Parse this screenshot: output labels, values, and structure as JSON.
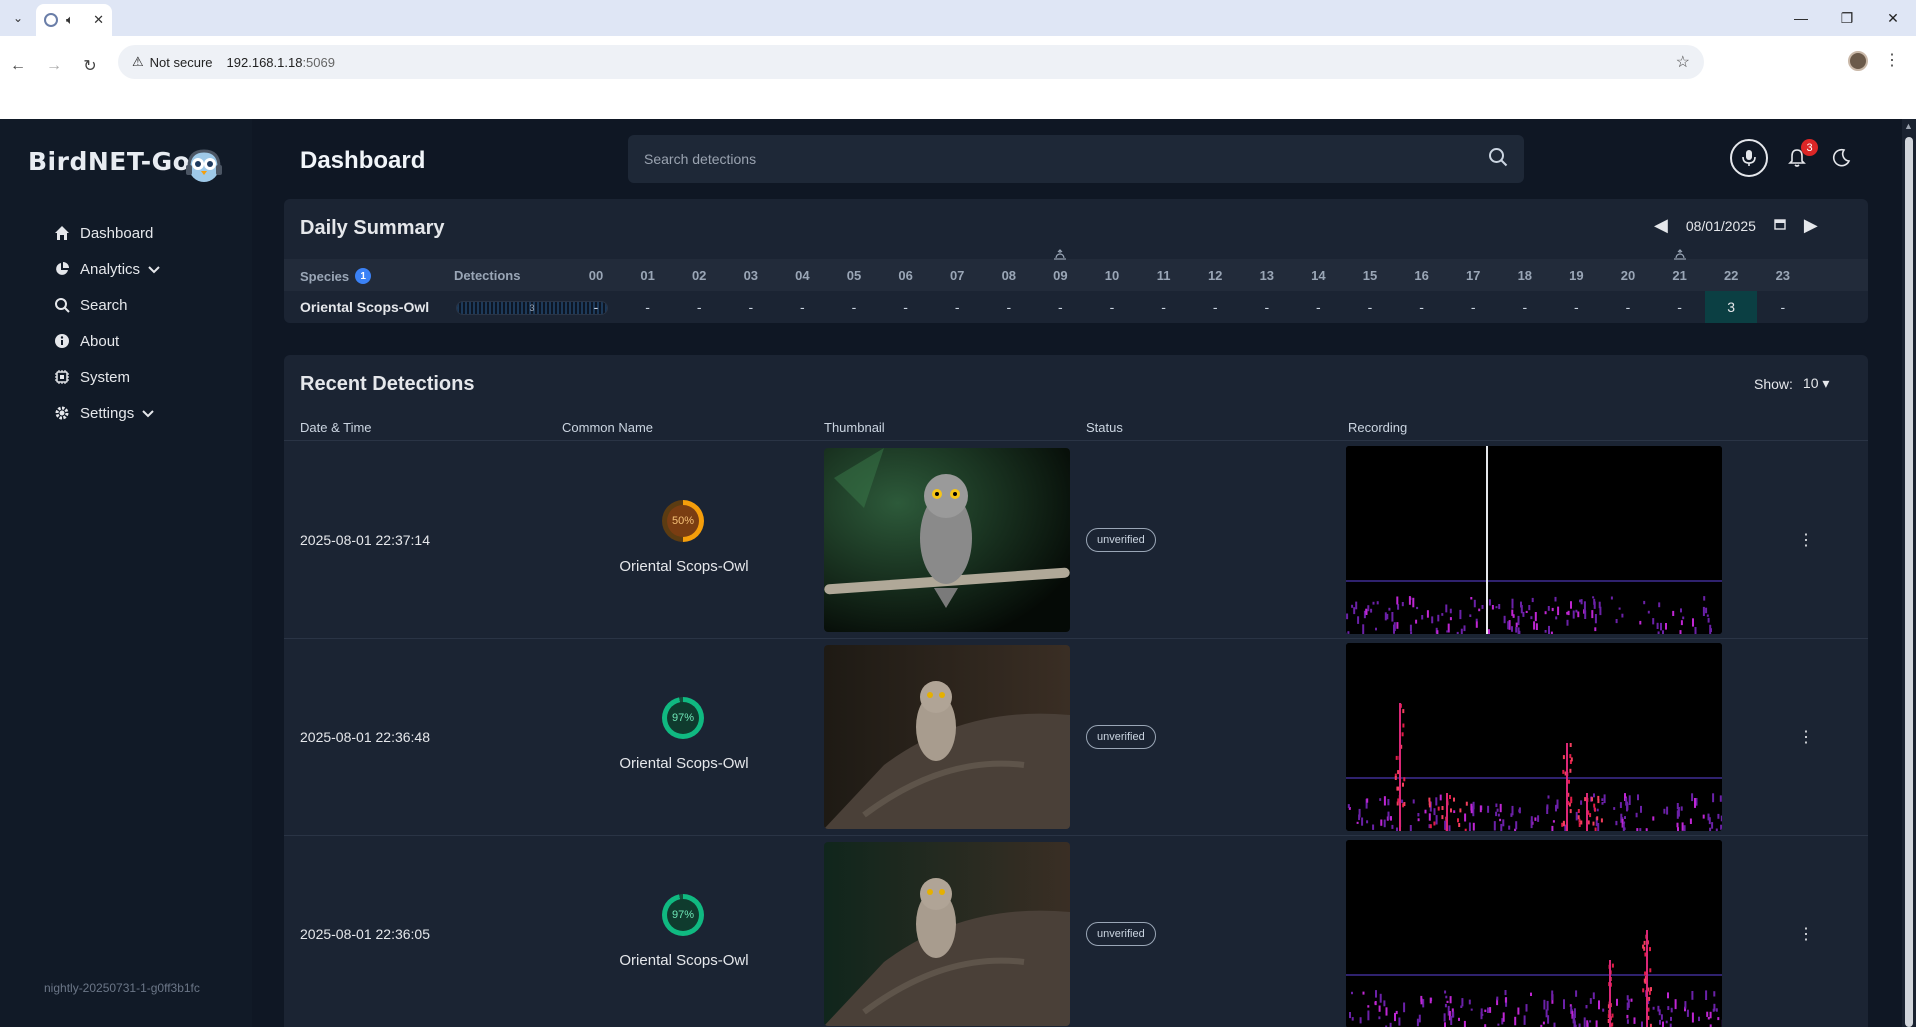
{
  "browser": {
    "tab_close": "✕",
    "omnibox": {
      "security": "Not secure",
      "host": "192.168.1.18",
      "port": ":5069"
    }
  },
  "sidebar": {
    "brand": "BirdNET-Go",
    "items": [
      {
        "label": "Dashboard",
        "icon": "home-icon"
      },
      {
        "label": "Analytics",
        "icon": "pie-chart-icon",
        "expandable": true
      },
      {
        "label": "Search",
        "icon": "search-icon"
      },
      {
        "label": "About",
        "icon": "info-icon"
      },
      {
        "label": "System",
        "icon": "cpu-icon"
      },
      {
        "label": "Settings",
        "icon": "gear-icon",
        "expandable": true
      }
    ],
    "version": "nightly-20250731-1-g0ff3b1fc"
  },
  "header": {
    "title": "Dashboard",
    "search_placeholder": "Search detections",
    "notification_count": "3"
  },
  "daily_summary": {
    "title": "Daily Summary",
    "date": "08/01/2025",
    "species_label": "Species",
    "species_count": "1",
    "detections_label": "Detections",
    "hours": [
      "00",
      "01",
      "02",
      "03",
      "04",
      "05",
      "06",
      "07",
      "08",
      "09",
      "10",
      "11",
      "12",
      "13",
      "14",
      "15",
      "16",
      "17",
      "18",
      "19",
      "20",
      "21",
      "22",
      "23"
    ],
    "rows": [
      {
        "species": "Oriental Scops-Owl",
        "total": "3",
        "cells": [
          "-",
          "-",
          "-",
          "-",
          "-",
          "-",
          "-",
          "-",
          "-",
          "-",
          "-",
          "-",
          "-",
          "-",
          "-",
          "-",
          "-",
          "-",
          "-",
          "-",
          "-",
          "-",
          "3",
          "-"
        ]
      }
    ]
  },
  "recent": {
    "title": "Recent Detections",
    "show_label": "Show:",
    "show_value": "10",
    "columns": {
      "datetime": "Date & Time",
      "name": "Common Name",
      "thumb": "Thumbnail",
      "status": "Status",
      "recording": "Recording"
    },
    "rows": [
      {
        "datetime": "2025-08-01 22:37:14",
        "confidence": "50%",
        "name": "Oriental Scops-Owl",
        "status": "unverified"
      },
      {
        "datetime": "2025-08-01 22:36:48",
        "confidence": "97%",
        "name": "Oriental Scops-Owl",
        "status": "unverified"
      },
      {
        "datetime": "2025-08-01 22:36:05",
        "confidence": "97%",
        "name": "Oriental Scops-Owl",
        "status": "unverified"
      }
    ]
  },
  "colors": {
    "accent": "#3b82f6",
    "low_conf": "#f59e0b",
    "high_conf": "#10b981",
    "hot_cell": "#0b3f43"
  }
}
